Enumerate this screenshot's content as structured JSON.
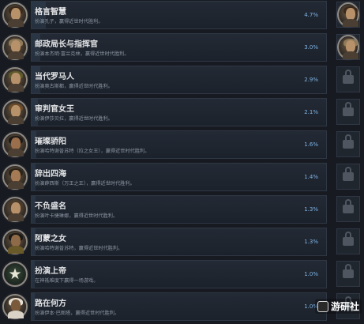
{
  "achievements": [
    {
      "title": "格言智慧",
      "desc": "扮演孔子，赢得近世时代胜利。",
      "pct": "4.7%",
      "pct_value": 4.7,
      "unlocked": true,
      "badge": "portrait-badge-icon"
    },
    {
      "title": "邮政局长与指挥官",
      "desc": "扮演本杰明·富兰克林，赢得近世时代胜利。",
      "pct": "3.0%",
      "pct_value": 3.0,
      "unlocked": true,
      "badge": "portrait-badge-icon"
    },
    {
      "title": "当代罗马人",
      "desc": "扮演奥古斯都，赢得近世时代胜利。",
      "pct": "2.9%",
      "pct_value": 2.9,
      "unlocked": false,
      "badge": "portrait-badge-icon"
    },
    {
      "title": "审判官女王",
      "desc": "扮演伊莎贝拉，赢得近世时代胜利。",
      "pct": "2.1%",
      "pct_value": 2.1,
      "unlocked": false,
      "badge": "portrait-badge-icon"
    },
    {
      "title": "璀璨骄阳",
      "desc": "扮演哈特谢普苏特（拉之女王），赢得近世时代胜利。",
      "pct": "1.6%",
      "pct_value": 1.6,
      "unlocked": false,
      "badge": "portrait-badge-icon"
    },
    {
      "title": "辞出四海",
      "desc": "扮演薛西斯（万王之王），赢得近世时代胜利。",
      "pct": "1.4%",
      "pct_value": 1.4,
      "unlocked": false,
      "badge": "portrait-badge-icon"
    },
    {
      "title": "不负盛名",
      "desc": "扮演叶卡捷琳娜，赢得近世时代胜利。",
      "pct": "1.3%",
      "pct_value": 1.3,
      "unlocked": false,
      "badge": "portrait-badge-icon"
    },
    {
      "title": "阿蒙之女",
      "desc": "扮演哈特谢普苏特，赢得近世时代胜利。",
      "pct": "1.3%",
      "pct_value": 1.3,
      "unlocked": false,
      "badge": "portrait-badge-icon"
    },
    {
      "title": "扮演上帝",
      "desc": "在神祗难度下赢得一场游戏。",
      "pct": "1.0%",
      "pct_value": 1.0,
      "unlocked": false,
      "badge": "star-badge-icon",
      "glyph": "★"
    },
    {
      "title": "路在何方",
      "desc": "扮演伊本·巴图塔，赢得近世时代胜利。",
      "pct": "1.0%",
      "pct_value": 1.0,
      "unlocked": false,
      "badge": "portrait-badge-icon"
    }
  ],
  "watermark": {
    "text": "游研社"
  },
  "colors": {
    "percent": "#7fb4e6",
    "background": "#171a21",
    "bar": "#232a35"
  }
}
